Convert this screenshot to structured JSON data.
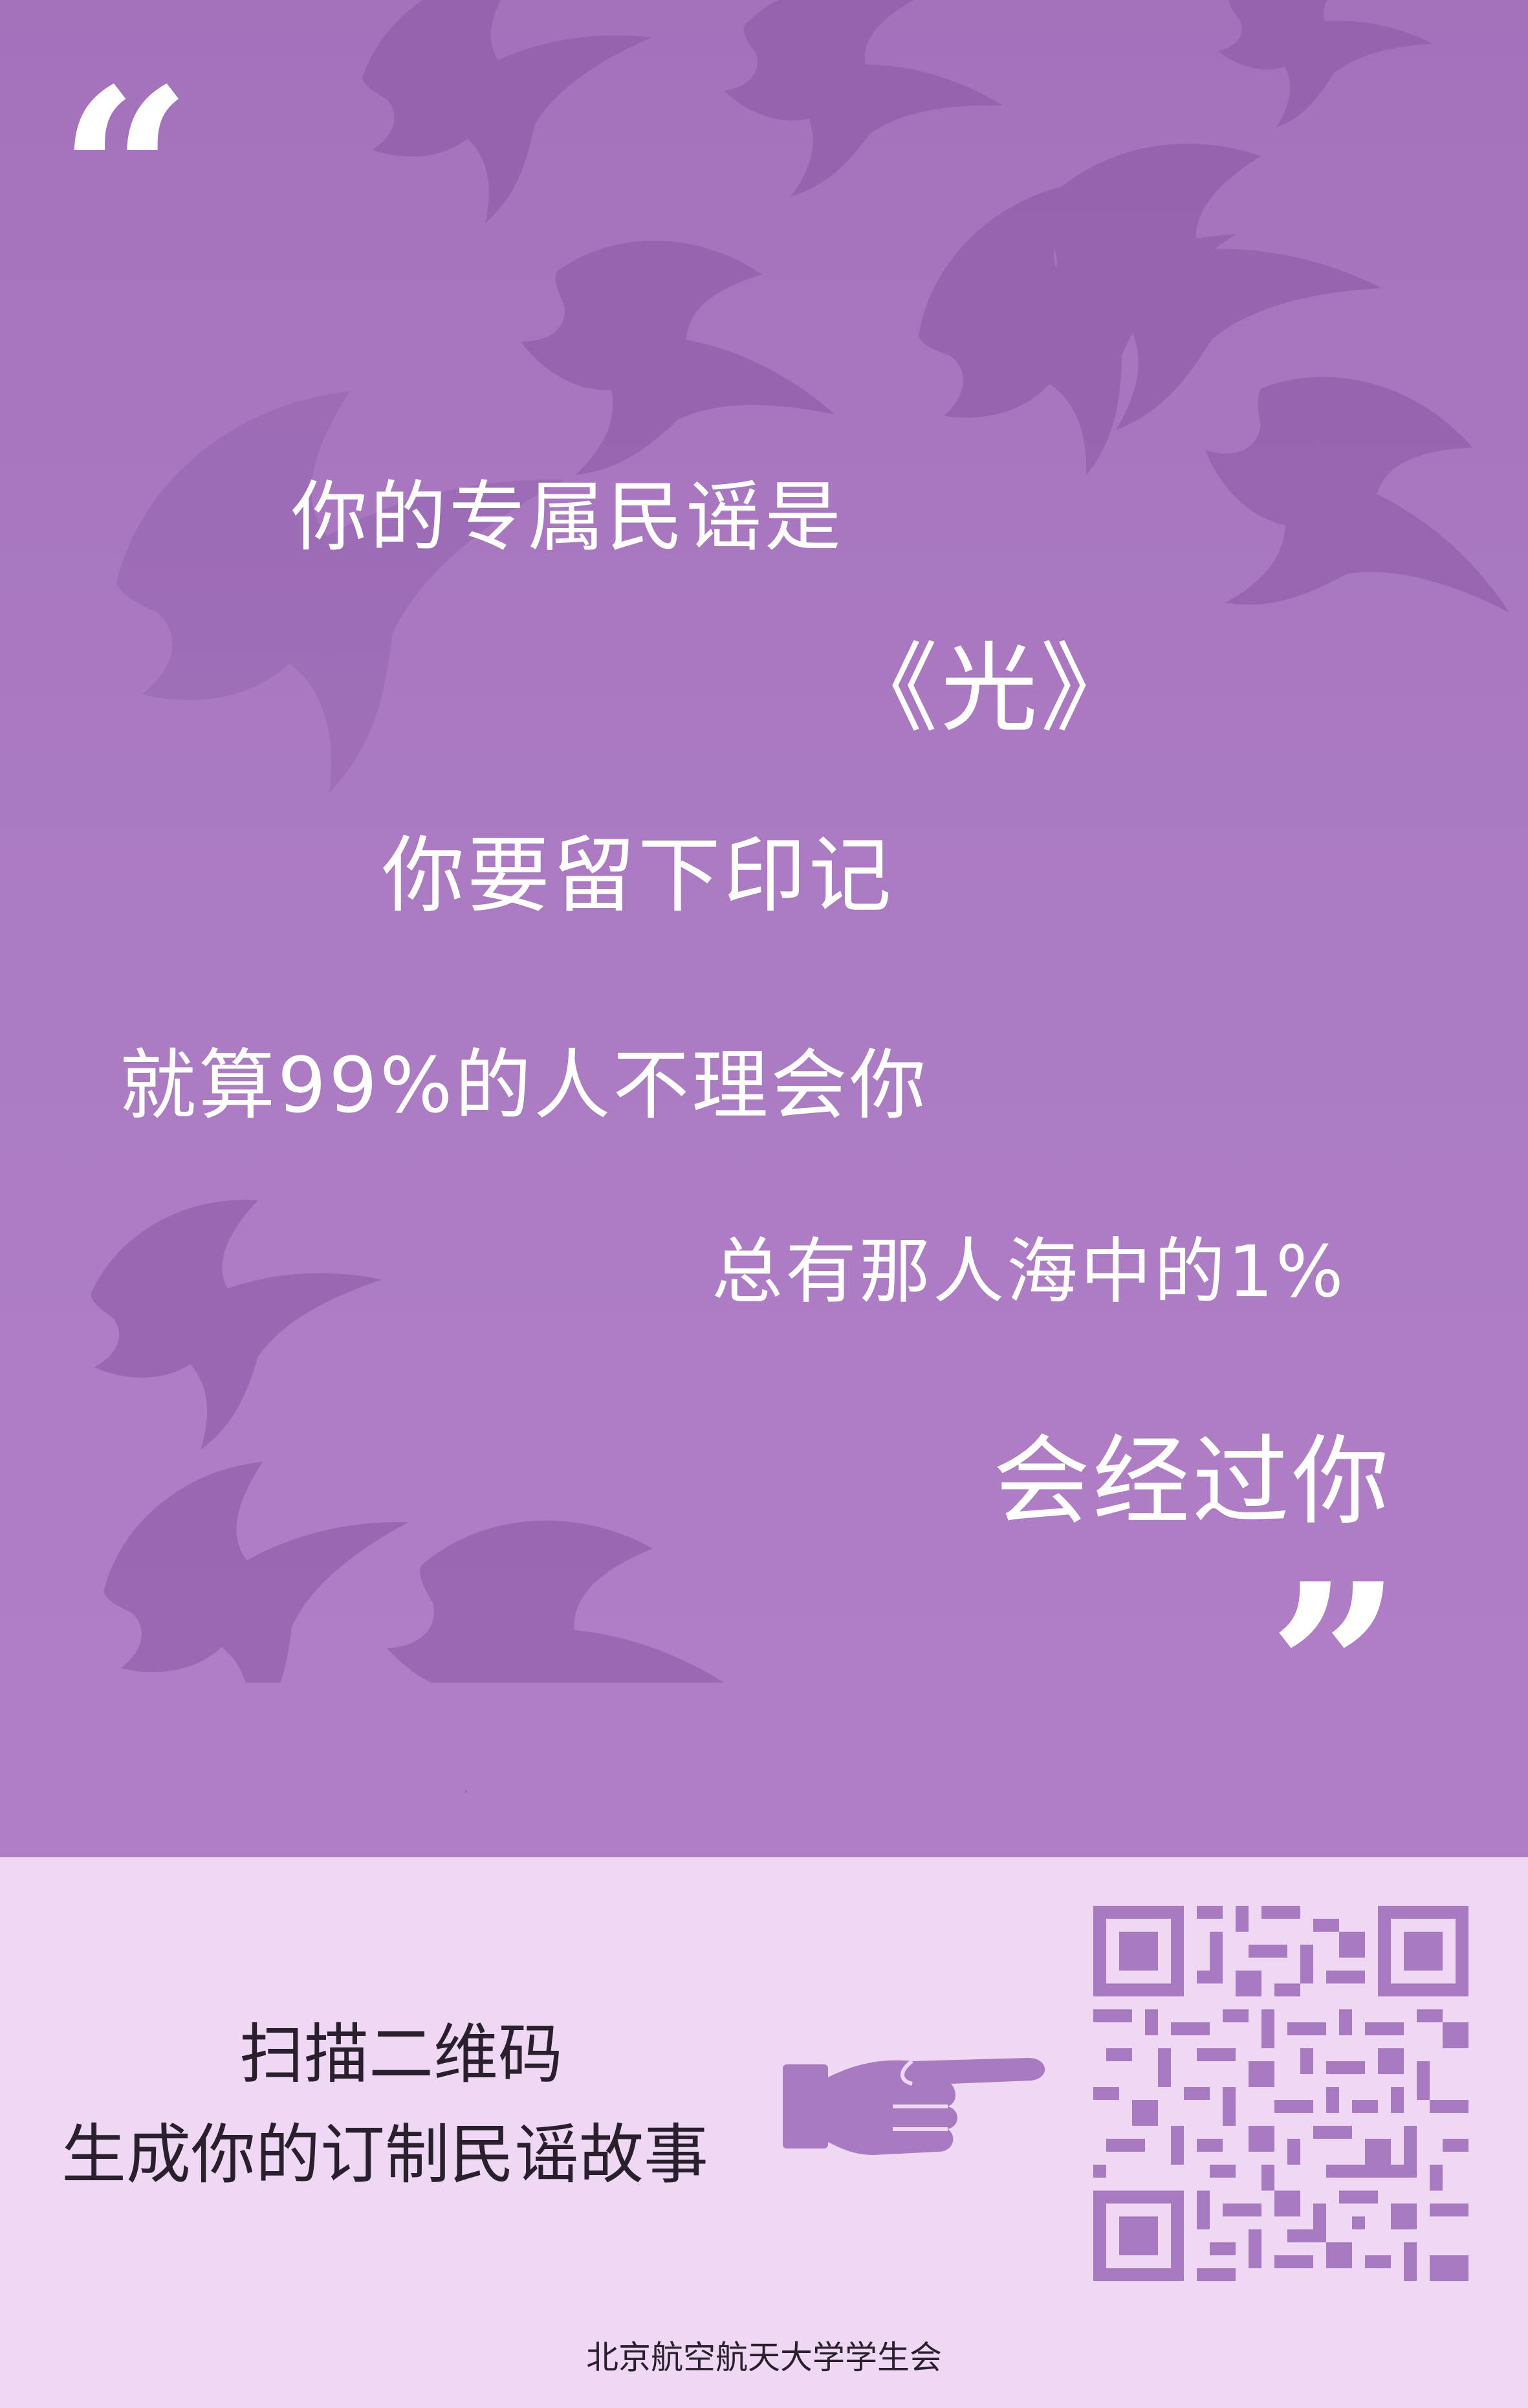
{
  "colors": {
    "top_background": "#a472bb",
    "bottom_background": "#efd8f4",
    "bird_color": "#8a58a5",
    "accent_purple": "#a87ac0",
    "text_light": "#ffffff",
    "text_dark": "#2a1f2d"
  },
  "quote": {
    "open": "“",
    "close": "”"
  },
  "message": {
    "line1": "你的专属民谣是",
    "line2": "《光》",
    "line3": "你要留下印记",
    "line4": "就算99%的人不理会你",
    "line5": "总有那人海中的1%",
    "line6": "会经过你"
  },
  "cta": {
    "line1": "扫描二维码",
    "line2": "生成你的订制民谣故事"
  },
  "icons": {
    "hand": "pointing-hand-icon",
    "qr": "qr-code",
    "bird": "dove-silhouette",
    "skyline": "city-skyline"
  },
  "footer": {
    "organization": "北京航空航天大学学生会"
  }
}
